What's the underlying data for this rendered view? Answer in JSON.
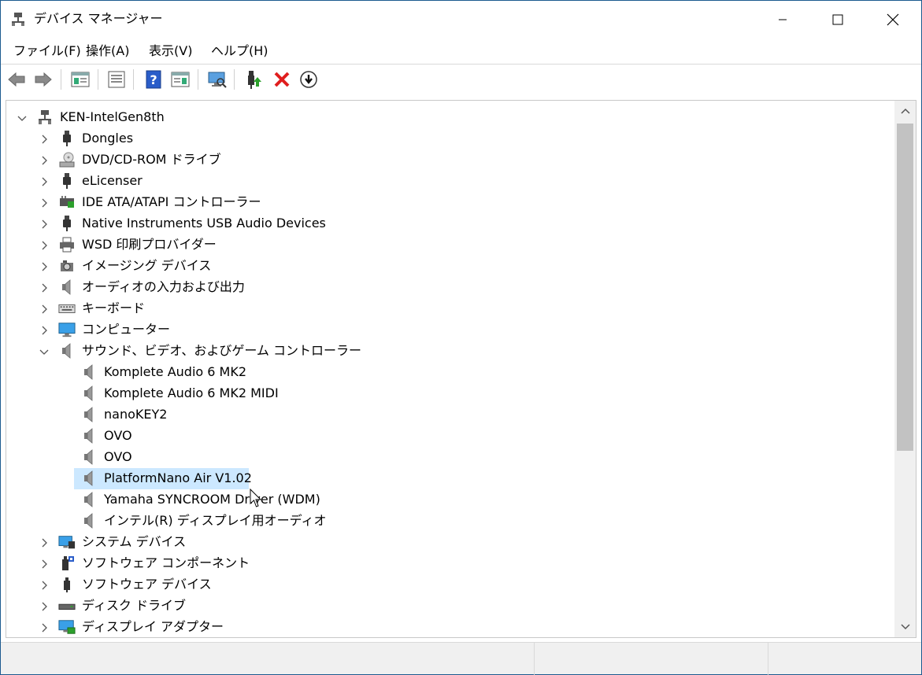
{
  "window": {
    "title": "デバイス マネージャー",
    "colors": {
      "selection": "#cce8ff",
      "frame": "#1c5a8f"
    }
  },
  "menu": [
    "ファイル(F)",
    "操作(A)",
    "表示(V)",
    "ヘルプ(H)"
  ],
  "toolbar": {
    "buttons": [
      "back-arrow-icon",
      "forward-arrow-icon",
      "show-hide-console-tree-icon",
      "properties-icon",
      "help-icon",
      "action-pane-icon",
      "scan-hardware-icon",
      "update-driver-icon",
      "uninstall-device-icon",
      "disable-device-icon"
    ]
  },
  "tree": {
    "root": "KEN-IntelGen8th",
    "items": [
      {
        "label": "Dongles",
        "icon": "usb-plug-icon",
        "expanded": false
      },
      {
        "label": "DVD/CD-ROM ドライブ",
        "icon": "dvd-drive-icon",
        "expanded": false
      },
      {
        "label": "eLicenser",
        "icon": "usb-plug-icon",
        "expanded": false
      },
      {
        "label": "IDE ATA/ATAPI コントローラー",
        "icon": "ide-controller-icon",
        "expanded": false
      },
      {
        "label": "Native Instruments USB Audio Devices",
        "icon": "usb-plug-icon",
        "expanded": false
      },
      {
        "label": "WSD 印刷プロバイダー",
        "icon": "printer-icon",
        "expanded": false
      },
      {
        "label": "イメージング デバイス",
        "icon": "camera-icon",
        "expanded": false
      },
      {
        "label": "オーディオの入力および出力",
        "icon": "speaker-icon",
        "expanded": false
      },
      {
        "label": "キーボード",
        "icon": "keyboard-icon",
        "expanded": false
      },
      {
        "label": "コンピューター",
        "icon": "monitor-icon",
        "expanded": false
      },
      {
        "label": "サウンド、ビデオ、およびゲーム コントローラー",
        "icon": "speaker-icon",
        "expanded": true,
        "children": [
          {
            "label": "Komplete Audio 6 MK2"
          },
          {
            "label": "Komplete Audio 6 MK2 MIDI"
          },
          {
            "label": "nanoKEY2"
          },
          {
            "label": "OVO"
          },
          {
            "label": "OVO"
          },
          {
            "label": "PlatformNano Air V1.02",
            "selected": true
          },
          {
            "label": "Yamaha SYNCROOM Driver (WDM)"
          },
          {
            "label": "インテル(R) ディスプレイ用オーディオ"
          }
        ]
      },
      {
        "label": "システム デバイス",
        "icon": "system-devices-icon",
        "expanded": false
      },
      {
        "label": "ソフトウェア コンポーネント",
        "icon": "software-component-icon",
        "expanded": false
      },
      {
        "label": "ソフトウェア デバイス",
        "icon": "software-device-icon",
        "expanded": false
      },
      {
        "label": "ディスク ドライブ",
        "icon": "disk-drive-icon",
        "expanded": false
      },
      {
        "label": "ディスプレイ アダプター",
        "icon": "display-adapter-icon",
        "expanded": false
      }
    ]
  }
}
